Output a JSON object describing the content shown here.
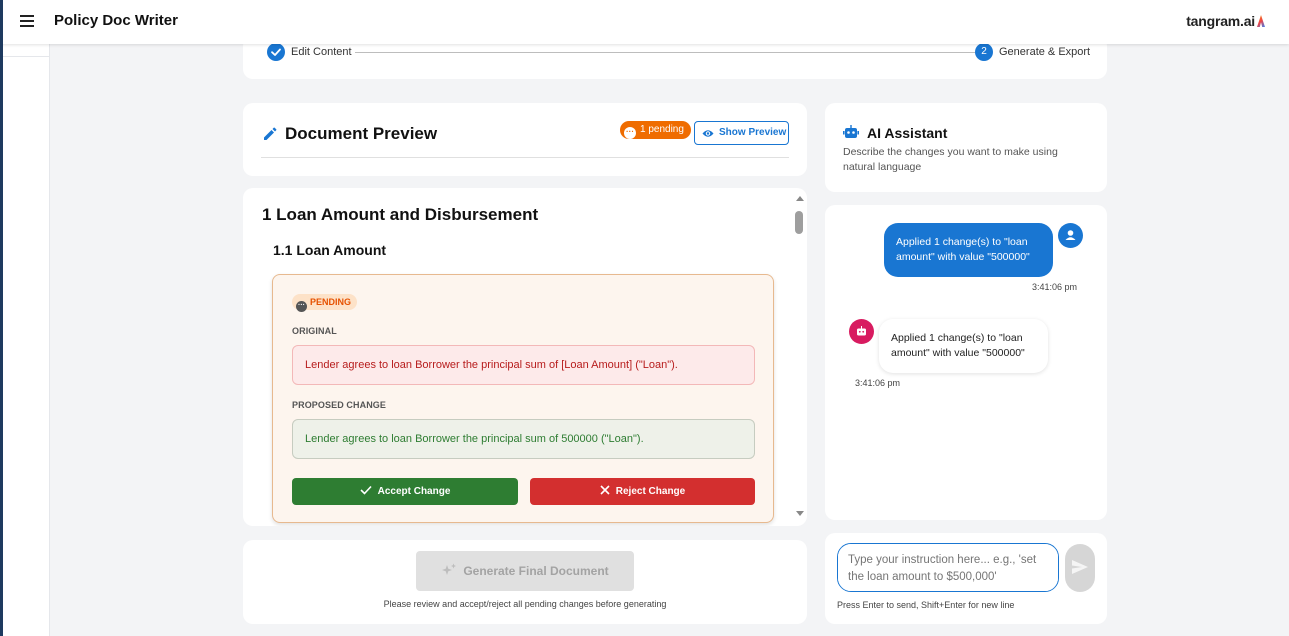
{
  "app": {
    "title": "Policy Doc Writer",
    "brand": "tangram.ai"
  },
  "stepper": {
    "steps": [
      {
        "label": "Edit Content",
        "state": "completed",
        "icon": "check-icon"
      },
      {
        "label": "Generate & Export",
        "number": "2",
        "state": "active"
      }
    ]
  },
  "preview": {
    "title": "Document Preview",
    "pending_badge": "1 pending",
    "show_preview_label": "Show Preview",
    "heading1": "1 Loan Amount and Disbursement",
    "heading2": "1.1 Loan Amount",
    "change": {
      "status": "PENDING",
      "original_label": "ORIGINAL",
      "original_text": "Lender agrees to loan Borrower the principal sum of [Loan Amount] (\"Loan\").",
      "proposed_label": "PROPOSED CHANGE",
      "proposed_text": "Lender agrees to loan Borrower the principal sum of 500000 (\"Loan\").",
      "accept_label": "Accept Change",
      "reject_label": "Reject Change"
    }
  },
  "generate": {
    "button_label": "Generate Final Document",
    "note": "Please review and accept/reject all pending changes before generating"
  },
  "assistant": {
    "title": "AI Assistant",
    "subtitle": "Describe the changes you want to make using natural language",
    "messages": [
      {
        "role": "user",
        "text": "Applied 1 change(s) to \"loan amount\" with value \"500000\"",
        "time": "3:41:06 pm"
      },
      {
        "role": "bot",
        "text": "Applied 1 change(s) to \"loan amount\" with value \"500000\"",
        "time": "3:41:06 pm"
      }
    ],
    "input_placeholder": "Type your instruction here... e.g., 'set the loan amount to $500,000'",
    "input_hint": "Press Enter to send, Shift+Enter for new line"
  },
  "colors": {
    "primary": "#1976d2",
    "accept": "#2e7d32",
    "reject": "#d32f2f",
    "pending": "#ef6c00",
    "bot_avatar": "#d81b60"
  }
}
